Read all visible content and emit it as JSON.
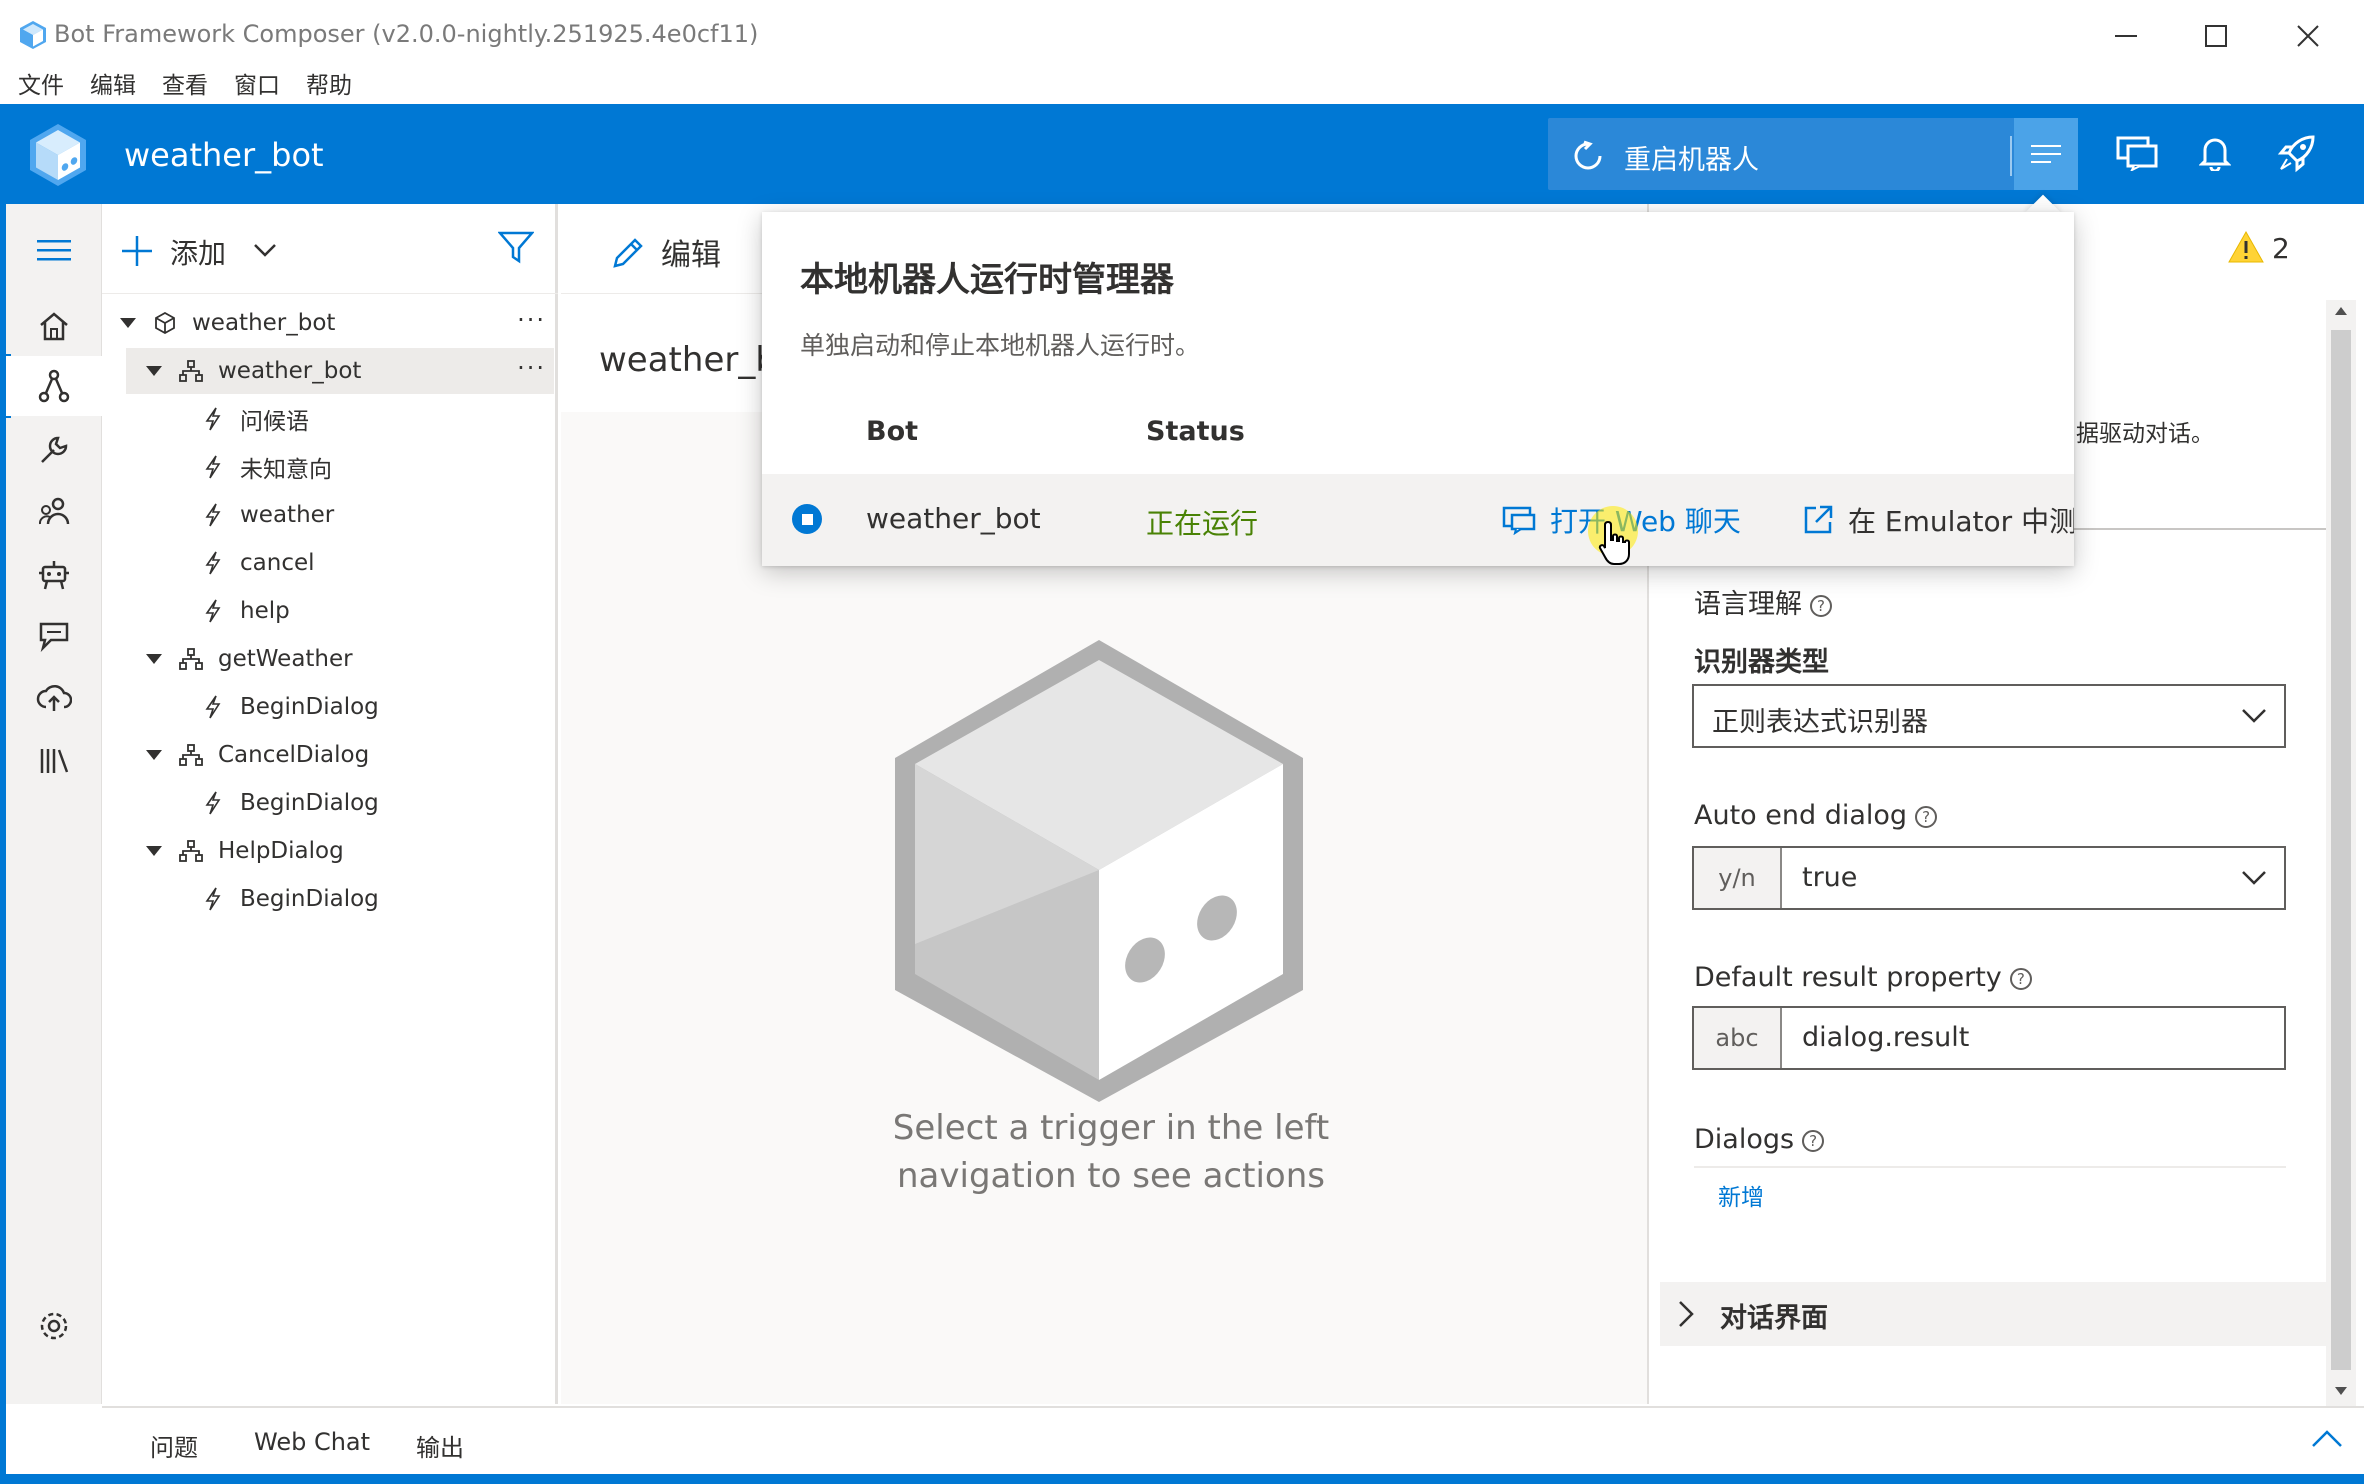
{
  "window": {
    "title": "Bot Framework Composer (v2.0.0-nightly.251925.4e0cf11)",
    "minimize_icon": "minimize-icon",
    "maximize_icon": "maximize-icon",
    "close_icon": "close-icon"
  },
  "menu": [
    "文件",
    "编辑",
    "查看",
    "窗口",
    "帮助"
  ],
  "header": {
    "bot_name": "weather_bot",
    "restart_label": "重启机器人",
    "accent": "#0078d4",
    "icons": [
      "chat-icon",
      "bell-icon",
      "rocket-icon"
    ]
  },
  "nav": [
    "home-icon",
    "flow-icon",
    "wrench-icon",
    "users-icon",
    "robot-icon",
    "chat-bubbles-icon",
    "cloud-upload-icon",
    "library-icon",
    "settings-icon"
  ],
  "tree": {
    "add_label": "添加",
    "items": [
      {
        "label": "weather_bot",
        "type": "bot",
        "level": 0,
        "caret": true,
        "more": true,
        "selected": false
      },
      {
        "label": "weather_bot",
        "type": "dialog",
        "level": 1,
        "caret": true,
        "more": true,
        "selected": true
      },
      {
        "label": "问候语",
        "type": "trigger",
        "level": 2
      },
      {
        "label": "未知意向",
        "type": "trigger",
        "level": 2
      },
      {
        "label": "weather",
        "type": "trigger",
        "level": 2
      },
      {
        "label": "cancel",
        "type": "trigger",
        "level": 2
      },
      {
        "label": "help",
        "type": "trigger",
        "level": 2
      },
      {
        "label": "getWeather",
        "type": "dialog",
        "level": 1,
        "caret": true
      },
      {
        "label": "BeginDialog",
        "type": "trigger",
        "level": 2
      },
      {
        "label": "CancelDialog",
        "type": "dialog",
        "level": 1,
        "caret": true
      },
      {
        "label": "BeginDialog",
        "type": "trigger",
        "level": 2
      },
      {
        "label": "HelpDialog",
        "type": "dialog",
        "level": 1,
        "caret": true
      },
      {
        "label": "BeginDialog",
        "type": "trigger",
        "level": 2
      }
    ]
  },
  "center": {
    "edit_label": "编辑",
    "dialog_heading": "weather_b",
    "empty_text_line1": "Select a trigger in the left",
    "empty_text_line2": "navigation to see actions"
  },
  "warnings": {
    "count": "2"
  },
  "properties": {
    "partial_text": "据驱动对话。",
    "language_understanding": "语言理解",
    "recognizer_type_label": "识别器类型",
    "recognizer_type_value": "正则表达式识别器",
    "auto_end_label": "Auto end dialog",
    "auto_end_prefix": "y/n",
    "auto_end_value": "true",
    "default_result_label": "Default result property",
    "default_result_prefix": "abc",
    "default_result_value": "dialog.result",
    "dialogs_label": "Dialogs",
    "add_link": "新增",
    "dialog_interface": "对话界面"
  },
  "popup": {
    "title": "本地机器人运行时管理器",
    "subtitle": "单独启动和停止本地机器人运行时。",
    "col_bot": "Bot",
    "col_status": "Status",
    "row_bot": "weather_bot",
    "row_status": "正在运行",
    "webchat_link": "打开 Web 聊天",
    "emulator_link": "在 Emulator 中测试",
    "status_color": "#498205"
  },
  "bottom_tabs": [
    "问题",
    "Web Chat",
    "输出"
  ]
}
